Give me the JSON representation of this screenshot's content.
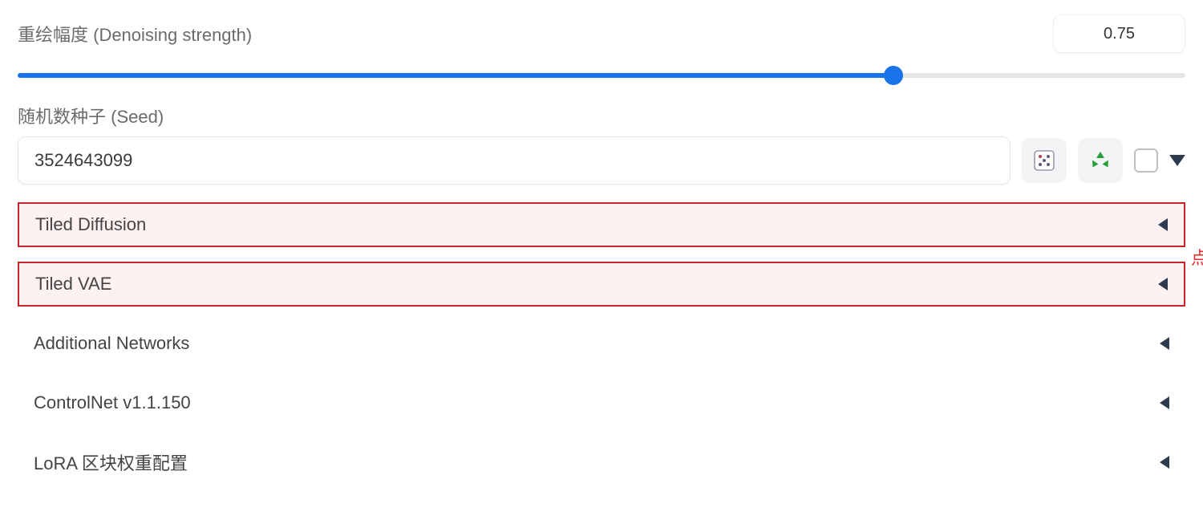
{
  "denoise": {
    "label": "重绘幅度 (Denoising strength)",
    "value": "0.75",
    "percent": 75
  },
  "seed": {
    "label": "随机数种子 (Seed)",
    "value": "3524643099"
  },
  "icons": {
    "dice": "dice-icon",
    "recycle": "recycle-icon"
  },
  "panels": [
    {
      "label": "Tiled Diffusion",
      "highlight": true
    },
    {
      "label": "Tiled VAE",
      "highlight": true
    },
    {
      "label": "Additional Networks",
      "highlight": false
    },
    {
      "label": "ControlNet v1.1.150",
      "highlight": false
    },
    {
      "label": "LoRA 区块权重配置",
      "highlight": false
    }
  ],
  "callout": "点击展开"
}
